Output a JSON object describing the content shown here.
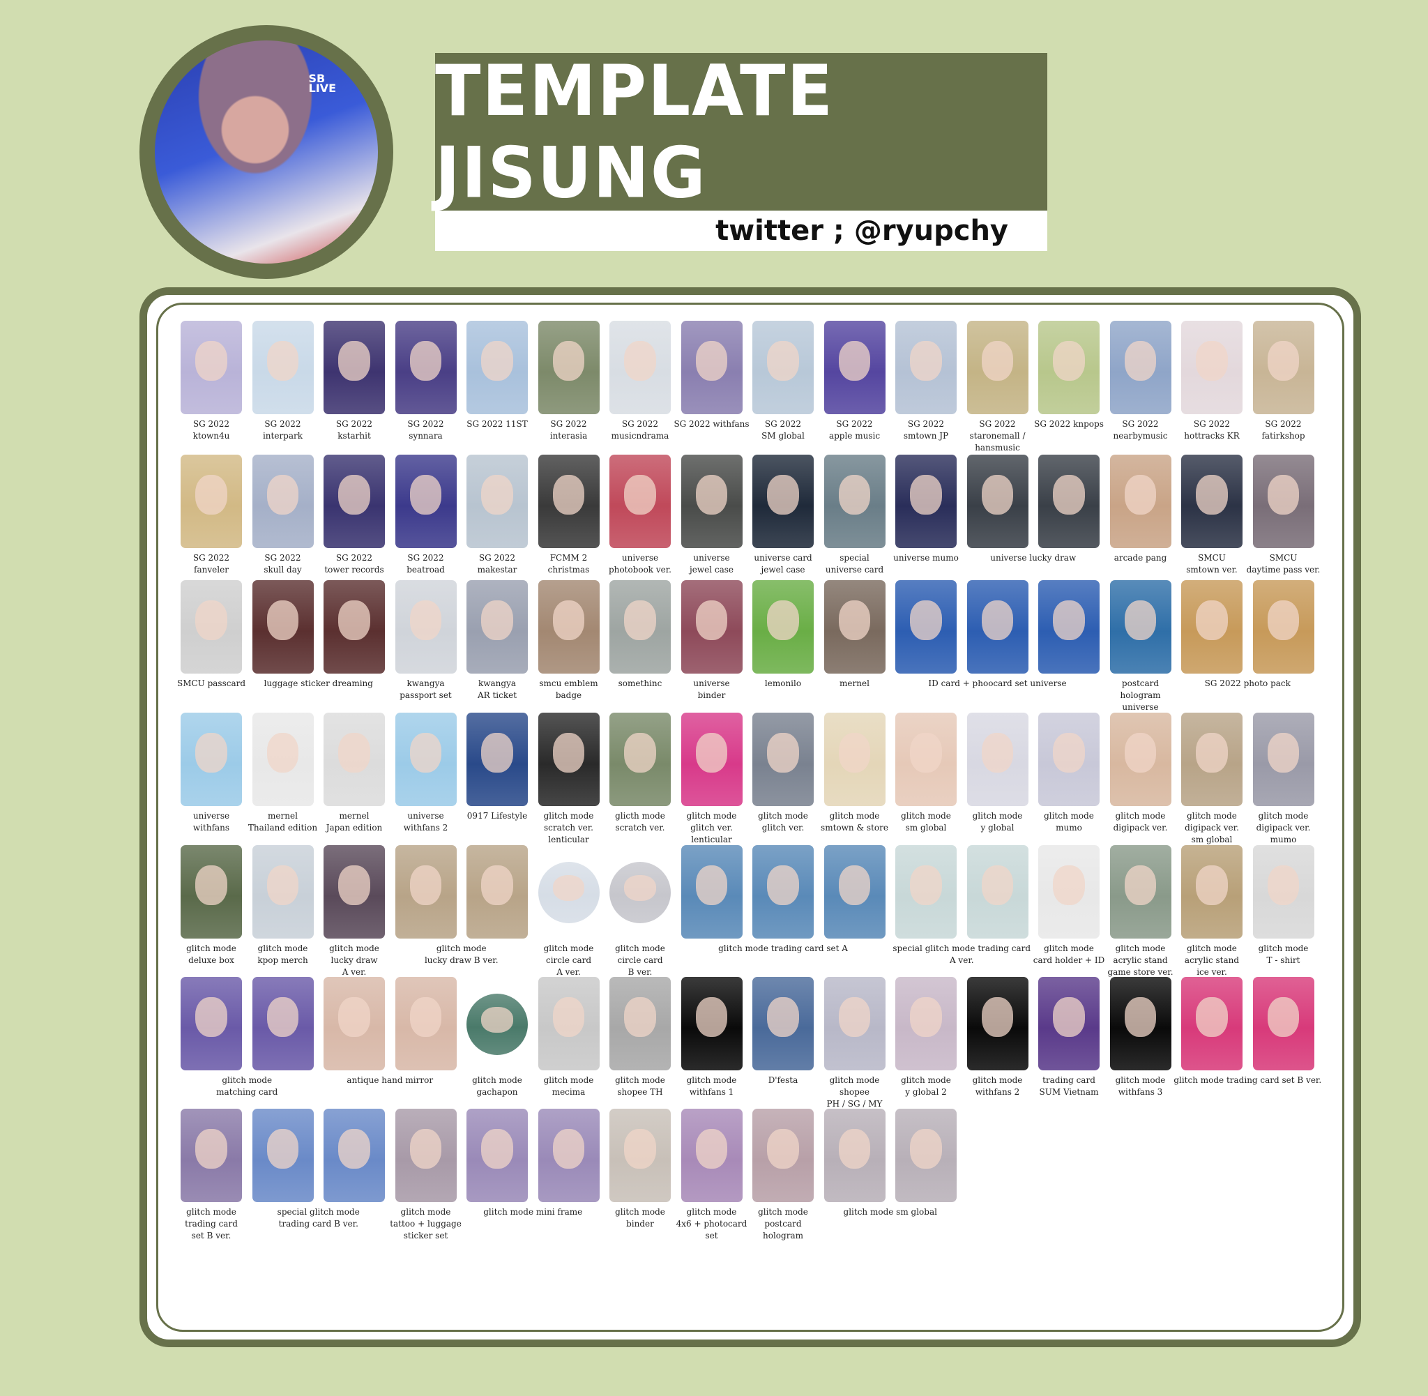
{
  "header": {
    "title": "TEMPLATE JISUNG",
    "handle": "twitter ; @ryupchy",
    "avatar_overlay": "SB\nLIVE"
  },
  "colors": {
    "background": "#d1ddb0",
    "accent": "#67714a",
    "panel": "#ffffff"
  },
  "rows": [
    {
      "items": [
        {
          "label": "SG 2022\nktown4u",
          "c": "#b9b3d8"
        },
        {
          "label": "SG 2022\ninterpark",
          "c": "#c9d9e8"
        },
        {
          "label": "SG 2022\nkstarhit",
          "c": "#3e3470"
        },
        {
          "label": "SG 2022\nsynnara",
          "c": "#4a3f86"
        },
        {
          "label": "SG 2022 11ST",
          "c": "#a9c1dc"
        },
        {
          "label": "SG 2022\ninterasia",
          "c": "#7d8a6a"
        },
        {
          "label": "SG 2022\nmusicndrama",
          "c": "#d8dde3"
        },
        {
          "label": "SG 2022 withfans",
          "c": "#8a7fb0"
        },
        {
          "label": "SG 2022\nSM global",
          "c": "#b8c8d8"
        },
        {
          "label": "SG 2022\napple music",
          "c": "#5546a0"
        },
        {
          "label": "SG 2022\nsmtown JP",
          "c": "#b5c2d5"
        },
        {
          "label": "SG 2022\nstaronemall /\nhansmusic",
          "c": "#c4b486"
        },
        {
          "label": "SG 2022 knpops",
          "c": "#b8c78c"
        },
        {
          "label": "SG 2022\nnearbymusic",
          "c": "#8fa5c8"
        },
        {
          "label": "SG 2022\nhottracks KR",
          "c": "#e3d8dc"
        },
        {
          "label": "SG 2022\nfatirkshop",
          "c": "#c8b596"
        }
      ]
    },
    {
      "items": [
        {
          "label": "SG 2022\nfanveler",
          "c": "#d2b985"
        },
        {
          "label": "SG 2022\nskull day",
          "c": "#a5b0c8"
        },
        {
          "label": "SG 2022\ntower records",
          "c": "#3a3470"
        },
        {
          "label": "SG 2022\nbeatroad",
          "c": "#3c3a8c"
        },
        {
          "label": "SG 2022\nmakestar",
          "c": "#b8c4d0"
        },
        {
          "label": "FCMM 2\nchristmas",
          "c": "#3a3a3a"
        },
        {
          "label": "universe\nphotobook ver.",
          "c": "#c0495a"
        },
        {
          "label": "universe\njewel case",
          "c": "#4a4c4a"
        },
        {
          "label": "universe card\njewel case",
          "c": "#1f2a3a"
        },
        {
          "label": "special\nuniverse card",
          "c": "#6a7e88"
        },
        {
          "label": "universe mumo",
          "c": "#2a2e5a"
        },
        {
          "label": "universe lucky draw",
          "c": "#3a4048",
          "span": 2
        },
        {
          "label": "arcade pang",
          "c": "#c9a487"
        },
        {
          "label": "SMCU\nsmtown ver.",
          "c": "#2c3346"
        },
        {
          "label": "SMCU\ndaytime pass ver.",
          "c": "#7a6e78"
        }
      ]
    },
    {
      "items": [
        {
          "label": "SMCU passcard",
          "c": "#cfcfcf"
        },
        {
          "label": "luggage sticker dreaming",
          "c": "#5b3030",
          "span": 2
        },
        {
          "label": "kwangya\npassport set",
          "c": "#d0d4da"
        },
        {
          "label": "kwangya\nAR ticket",
          "c": "#9aa0b0"
        },
        {
          "label": "smcu emblem\nbadge",
          "c": "#a38872"
        },
        {
          "label": "somethinc",
          "c": "#9ea5a2"
        },
        {
          "label": "universe\nbinder",
          "c": "#8e4a5a"
        },
        {
          "label": "lemonilo",
          "c": "#6aae46"
        },
        {
          "label": "mernel",
          "c": "#7a6a5e"
        },
        {
          "label": "ID card + phoocard set universe",
          "c": "#2d5eb2",
          "span": 3
        },
        {
          "label": "postcard\nhologram\nuniverse",
          "c": "#2f6fa8"
        },
        {
          "label": "SG 2022 photo pack",
          "c": "#c79a5a",
          "span": 2
        }
      ]
    },
    {
      "items": [
        {
          "label": "universe\nwithfans",
          "c": "#9ccbe8"
        },
        {
          "label": "mernel\nThailand edition",
          "c": "#e8e8e8"
        },
        {
          "label": "mernel\nJapan edition",
          "c": "#dcdcdc"
        },
        {
          "label": "universe\nwithfans 2",
          "c": "#9ccbe8"
        },
        {
          "label": "0917 Lifestyle",
          "c": "#2a4a8a"
        },
        {
          "label": "glitch mode\nscratch ver.\nlenticular",
          "c": "#2a2a2a"
        },
        {
          "label": "glicth mode\nscratch ver.",
          "c": "#7a8a6a"
        },
        {
          "label": "glitch mode\nglitch ver.\nlenticular",
          "c": "#d83a8a"
        },
        {
          "label": "glitch mode\nglitch ver.",
          "c": "#7a8290"
        },
        {
          "label": "glitch mode\nsmtown & store",
          "c": "#e4d6b8"
        },
        {
          "label": "glitch mode\nsm global",
          "c": "#e6c9b8"
        },
        {
          "label": "glitch mode\ny global",
          "c": "#d8d8e2"
        },
        {
          "label": "glitch mode\nmumo",
          "c": "#c8c8d8"
        },
        {
          "label": "glitch mode\ndigipack ver.",
          "c": "#d8b8a0"
        },
        {
          "label": "glitch mode\ndigipack ver.\nsm global",
          "c": "#b8a488"
        },
        {
          "label": "glitch mode\ndigipack ver.\nmumo",
          "c": "#9a9aa8"
        }
      ]
    },
    {
      "items": [
        {
          "label": "glitch mode\ndeluxe box",
          "c": "#5a6a4a"
        },
        {
          "label": "glitch mode\nkpop merch",
          "c": "#c8d0d8"
        },
        {
          "label": "glitch mode\nlucky draw\nA ver.",
          "c": "#5a4a5a"
        },
        {
          "label": "glitch mode\nlucky draw B ver.",
          "c": "#b8a488",
          "span": 2
        },
        {
          "label": "glitch mode\ncircle card\nA ver.",
          "c": "#d6dde6",
          "circle": true
        },
        {
          "label": "glitch mode\ncircle card\nB ver.",
          "c": "#c6c6cc",
          "circle": true
        },
        {
          "label": "glitch mode trading card set A",
          "c": "#5a8ab8",
          "span": 3
        },
        {
          "label": "special glitch mode trading card\nA ver.",
          "c": "#c8d8d8",
          "span": 2
        },
        {
          "label": "glitch mode\ncard holder + ID",
          "c": "#e8e8e8"
        },
        {
          "label": "glitch mode\nacrylic stand\ngame store ver.",
          "c": "#8a9a8a"
        },
        {
          "label": "glitch mode\nacrylic stand\nice ver.",
          "c": "#b8a078"
        },
        {
          "label": "glitch mode\nT - shirt",
          "c": "#d8d8d8"
        }
      ]
    },
    {
      "items": [
        {
          "label": "glitch mode\nmatching card",
          "c": "#6a5aa8",
          "span": 2
        },
        {
          "label": "antique hand mirror",
          "c": "#d8b8a8",
          "span": 2
        },
        {
          "label": "glitch mode\ngachapon",
          "c": "#4a7a6a",
          "circle": true
        },
        {
          "label": "glitch mode\nmecima",
          "c": "#c8c8c8"
        },
        {
          "label": "glitch mode\nshopee TH",
          "c": "#a8a8a8"
        },
        {
          "label": "glitch mode\nwithfans 1",
          "c": "#0a0a0a"
        },
        {
          "label": "D'festa",
          "c": "#4a6a9a"
        },
        {
          "label": "glitch mode\nshopee\nPH / SG / MY",
          "c": "#b8b8c8"
        },
        {
          "label": "glitch mode\ny global 2",
          "c": "#c8b8c8"
        },
        {
          "label": "glitch mode\nwithfans 2",
          "c": "#0a0a0a"
        },
        {
          "label": "trading card\nSUM Vietnam",
          "c": "#5a3a8a"
        },
        {
          "label": "glitch mode\nwithfans 3",
          "c": "#0a0a0a"
        },
        {
          "label": "glitch mode trading card set B ver.",
          "c": "#d83a7a",
          "span": 2
        }
      ]
    },
    {
      "items": [
        {
          "label": "glitch mode\ntrading card\nset B ver.",
          "c": "#8a7aa8"
        },
        {
          "label": "special glitch mode\ntrading card B ver.",
          "c": "#6a8ac8",
          "span": 2
        },
        {
          "label": "glitch mode\ntattoo + luggage\nsticker set",
          "c": "#a89aa8"
        },
        {
          "label": "glitch mode mini frame",
          "c": "#9a8ab8",
          "span": 2
        },
        {
          "label": "glitch mode\nbinder",
          "c": "#c8c0b8"
        },
        {
          "label": "glitch mode\n4x6 + photocard\nset",
          "c": "#a88ab8"
        },
        {
          "label": "glitch mode\npostcard\nhologram",
          "c": "#b8a0a8"
        },
        {
          "label": "glitch mode sm global",
          "c": "#b8b0b8",
          "span": 2
        }
      ]
    }
  ]
}
